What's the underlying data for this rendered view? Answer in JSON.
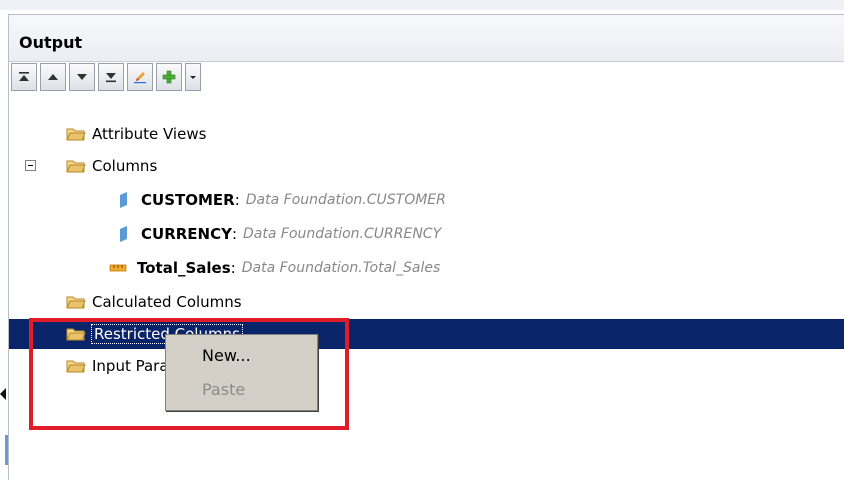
{
  "panel": {
    "title": "Output"
  },
  "toolbar": {
    "buttons": [
      {
        "icon": "move-to-top-icon"
      },
      {
        "icon": "move-up-icon"
      },
      {
        "icon": "move-down-icon"
      },
      {
        "icon": "move-to-bottom-icon"
      },
      {
        "icon": "edit-pencil-icon"
      },
      {
        "icon": "add-plus-icon"
      },
      {
        "icon": "dropdown-arrow-icon"
      }
    ]
  },
  "tree": {
    "attribute_views": "Attribute Views",
    "columns": "Columns",
    "column_items": [
      {
        "name": "CUSTOMER",
        "sep": ":",
        "source": "Data Foundation.CUSTOMER",
        "icon": "attribute-column-icon"
      },
      {
        "name": "CURRENCY",
        "sep": ":",
        "source": "Data Foundation.CURRENCY",
        "icon": "attribute-column-icon"
      },
      {
        "name": "Total_Sales",
        "sep": ":",
        "source": "Data Foundation.Total_Sales",
        "icon": "measure-column-icon"
      }
    ],
    "calculated_columns": "Calculated Columns",
    "restricted_columns": "Restricted Columns",
    "input_parameters": "Input Parameters"
  },
  "context_menu": {
    "items": [
      {
        "label": "New...",
        "enabled": true
      },
      {
        "label": "Paste",
        "enabled": false
      }
    ]
  },
  "colors": {
    "selection": "#0a246a",
    "highlight_border": "#e11b27",
    "folder_yellow": "#e8c36a"
  }
}
